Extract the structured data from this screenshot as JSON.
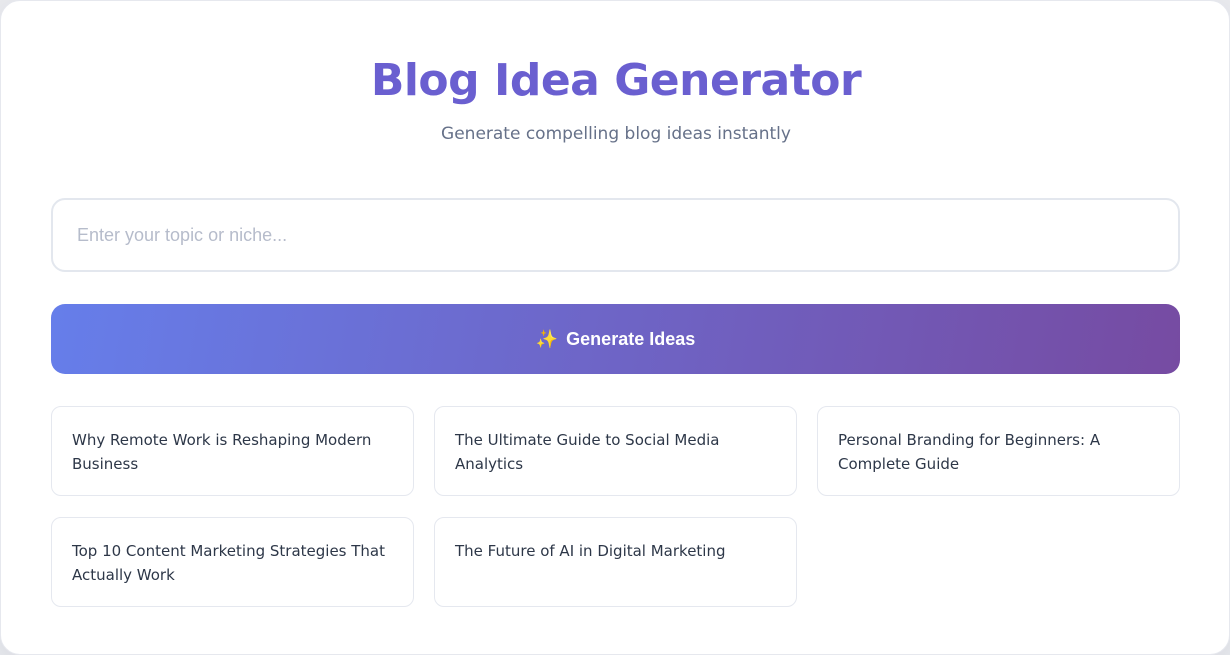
{
  "header": {
    "title": "Blog Idea Generator",
    "subtitle": "Generate compelling blog ideas instantly"
  },
  "search": {
    "placeholder": "Enter your topic or niche...",
    "value": ""
  },
  "generate_button": {
    "icon": "✨",
    "label": "Generate Ideas"
  },
  "ideas": [
    "Why Remote Work is Reshaping Modern Business",
    "The Ultimate Guide to Social Media Analytics",
    "Personal Branding for Beginners: A Complete Guide",
    "Top 10 Content Marketing Strategies That Actually Work",
    "The Future of AI in Digital Marketing"
  ],
  "colors": {
    "title": "#6a5fd0",
    "gradient_start": "#667eea",
    "gradient_end": "#764ba2",
    "text": "#2d3748",
    "muted": "#667189"
  }
}
